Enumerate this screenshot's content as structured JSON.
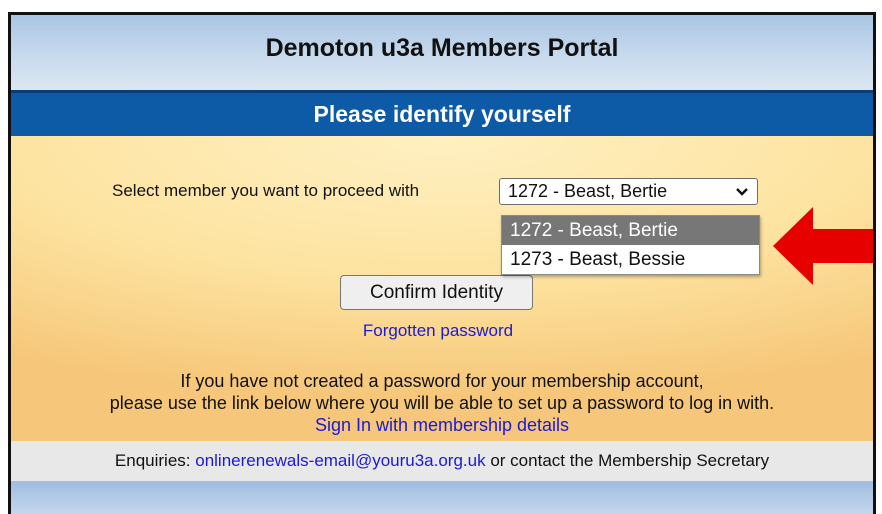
{
  "portal": {
    "title": "Demoton u3a Members Portal",
    "subtitle": "Please identify yourself"
  },
  "form": {
    "select_label": "Select member you want to proceed with",
    "selected_value": "1272 - Beast, Bertie",
    "options": [
      "1272 - Beast, Bertie",
      "1273 - Beast, Bessie"
    ],
    "confirm_label": "Confirm Identity",
    "forgotten_label": "Forgotten password"
  },
  "info": {
    "line1": "If you have not created a password for your membership account,",
    "line2": "please use the link below where you will be able to set up a password to log in with.",
    "signin_label": "Sign In with membership details"
  },
  "footer": {
    "prefix": "Enquiries: ",
    "email": "onlinerenewals-email@youru3a.org.uk",
    "suffix": " or contact the Membership Secretary"
  },
  "colors": {
    "header_bar": "#0d5aa7",
    "link": "#1a1ad6",
    "annotation_arrow": "#e60000",
    "selected_option": "#777777"
  },
  "icons": {
    "select": "chevron-down-icon",
    "annotation": "red-arrow-icon"
  }
}
